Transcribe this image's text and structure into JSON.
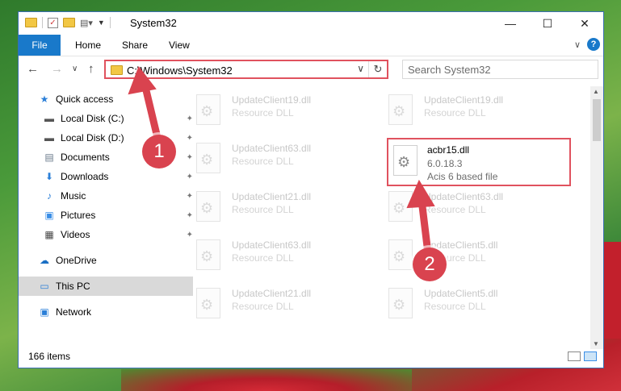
{
  "window": {
    "title": "System32",
    "controls": {
      "minimize": "—",
      "maximize": "☐",
      "close": "✕"
    }
  },
  "ribbon": {
    "tabs": [
      "File",
      "Home",
      "Share",
      "View"
    ],
    "help": "?",
    "collapse": "∨"
  },
  "navigation": {
    "back": "←",
    "forward": "→",
    "recent": "∨",
    "up": "↑",
    "address": "C:\\Windows\\System32",
    "address_dropdown": "∨",
    "refresh": "↻",
    "search_placeholder": "Search System32"
  },
  "sidebar": {
    "items": [
      {
        "label": "Quick access",
        "icon": "star-icon",
        "glyph": "★",
        "color": "#2b7fd8",
        "pinned": false,
        "level": 0
      },
      {
        "label": "Local Disk (C:)",
        "icon": "drive-icon",
        "glyph": "▬",
        "color": "#555555",
        "pinned": true,
        "level": 1
      },
      {
        "label": "Local Disk (D:)",
        "icon": "drive-icon",
        "glyph": "▬",
        "color": "#555555",
        "pinned": true,
        "level": 1
      },
      {
        "label": "Documents",
        "icon": "documents-icon",
        "glyph": "▤",
        "color": "#6b7b8c",
        "pinned": true,
        "level": 1
      },
      {
        "label": "Downloads",
        "icon": "download-icon",
        "glyph": "⬇",
        "color": "#2b7fd8",
        "pinned": true,
        "level": 1
      },
      {
        "label": "Music",
        "icon": "music-icon",
        "glyph": "♪",
        "color": "#2b7fd8",
        "pinned": true,
        "level": 1
      },
      {
        "label": "Pictures",
        "icon": "pictures-icon",
        "glyph": "▣",
        "color": "#3a8ee6",
        "pinned": true,
        "level": 1
      },
      {
        "label": "Videos",
        "icon": "videos-icon",
        "glyph": "▦",
        "color": "#444444",
        "pinned": true,
        "level": 1
      },
      {
        "label": "OneDrive",
        "icon": "cloud-icon",
        "glyph": "☁",
        "color": "#1a6fc4",
        "pinned": false,
        "level": 0
      },
      {
        "label": "This PC",
        "icon": "computer-icon",
        "glyph": "▭",
        "color": "#2b7fd8",
        "pinned": false,
        "level": 0,
        "selected": true
      },
      {
        "label": "Network",
        "icon": "network-icon",
        "glyph": "▣",
        "color": "#2b7fd8",
        "pinned": false,
        "level": 0
      }
    ],
    "pin_glyph": "📌"
  },
  "files": [
    {
      "name": "UpdateClient19.dll",
      "type": "Resource DLL",
      "faded": true
    },
    {
      "name": "UpdateClient19.dll",
      "type": "Resource DLL",
      "faded": true
    },
    {
      "name": "UpdateClient63.dll",
      "type": "Resource DLL",
      "faded": true
    },
    {
      "name": "acbr15.dll",
      "type": "6.0.18.3",
      "description": "Acis 6 based file",
      "highlighted": true
    },
    {
      "name": "UpdateClient21.dll",
      "type": "Resource DLL",
      "faded": true
    },
    {
      "name": "UpdateClient63.dll",
      "type": "Resource DLL",
      "faded": true
    },
    {
      "name": "UpdateClient63.dll",
      "type": "Resource DLL",
      "faded": true
    },
    {
      "name": "UpdateClient5.dll",
      "type": "Resource DLL",
      "faded": true
    },
    {
      "name": "UpdateClient21.dll",
      "type": "Resource DLL",
      "faded": true
    },
    {
      "name": "UpdateClient5.dll",
      "type": "Resource DLL",
      "faded": true
    }
  ],
  "status": {
    "item_count": "166 items"
  },
  "markers": [
    {
      "label": "1",
      "color": "#d9434f"
    },
    {
      "label": "2",
      "color": "#d9434f"
    }
  ],
  "colors": {
    "accent": "#1979ca",
    "highlight": "#e0525e"
  }
}
